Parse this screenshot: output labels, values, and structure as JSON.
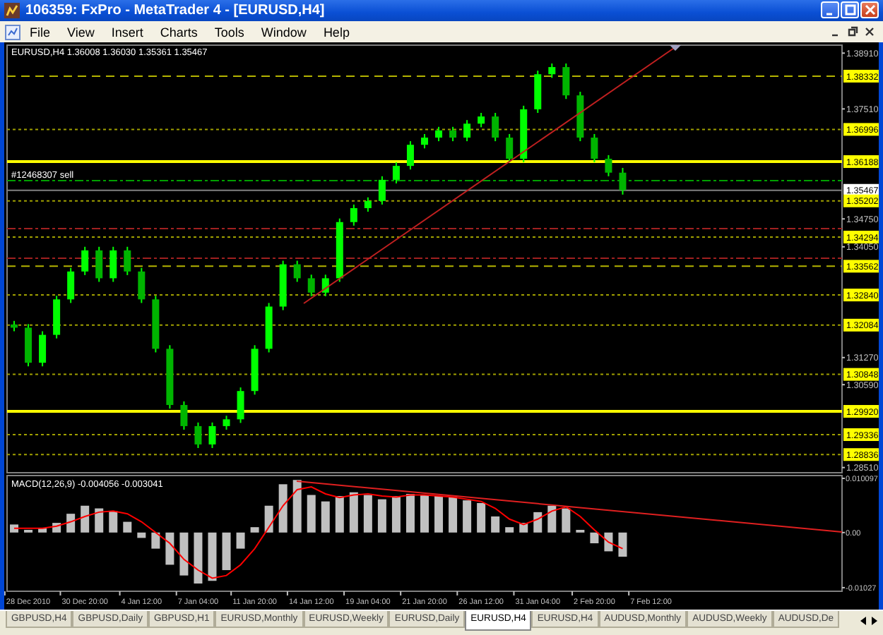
{
  "window": {
    "title": "106359: FxPro - MetaTrader 4 - [EURUSD,H4]"
  },
  "menu": [
    "File",
    "View",
    "Insert",
    "Charts",
    "Tools",
    "Window",
    "Help"
  ],
  "chart": {
    "header": "EURUSD,H4  1.36008 1.36030 1.35361 1.35467",
    "order_label": "#12468307 sell",
    "chart_data": {
      "type": "candlestick",
      "ylim": [
        1.2838,
        1.3911
      ],
      "categories": [
        null,
        null,
        null,
        null,
        null,
        null,
        null,
        null,
        null,
        null,
        null,
        null,
        null,
        null,
        null,
        null,
        null,
        null,
        null,
        null,
        null,
        null,
        null,
        null,
        null,
        null,
        null,
        null,
        null,
        null,
        null,
        null,
        null,
        null,
        null,
        null,
        null,
        null,
        null,
        null,
        null,
        null,
        null,
        null,
        null,
        null,
        null,
        null,
        null,
        null,
        null,
        null,
        null,
        null,
        null,
        null,
        null,
        null,
        null
      ],
      "yticks": [
        {
          "value": 1.3891,
          "label": "1.38910"
        },
        {
          "value": 1.3751,
          "label": "1.37510"
        },
        {
          "value": 1.3475,
          "label": "1.34750"
        },
        {
          "value": 1.3405,
          "label": "1.34050"
        },
        {
          "value": 1.3127,
          "label": "1.31270"
        },
        {
          "value": 1.3059,
          "label": "1.30590"
        },
        {
          "value": 1.2851,
          "label": "1.28510"
        }
      ],
      "ohlc": [
        [
          1.321,
          1.3219,
          1.3193,
          1.3202
        ],
        [
          1.3202,
          1.3211,
          1.3105,
          1.3114
        ],
        [
          1.3114,
          1.3193,
          1.3105,
          1.3184
        ],
        [
          1.3184,
          1.3282,
          1.3175,
          1.3273
        ],
        [
          1.3273,
          1.3352,
          1.3264,
          1.3343
        ],
        [
          1.3343,
          1.3405,
          1.3334,
          1.3396
        ],
        [
          1.3396,
          1.3405,
          1.3317,
          1.3326
        ],
        [
          1.3326,
          1.3405,
          1.3317,
          1.3396
        ],
        [
          1.3396,
          1.3405,
          1.3334,
          1.3343
        ],
        [
          1.3343,
          1.3352,
          1.3264,
          1.3273
        ],
        [
          1.3273,
          1.3282,
          1.314,
          1.3149
        ],
        [
          1.3149,
          1.3158,
          1.2999,
          1.3008
        ],
        [
          1.3008,
          1.3017,
          1.2946,
          1.2955
        ],
        [
          1.2955,
          1.2964,
          1.29,
          1.2909
        ],
        [
          1.2909,
          1.2964,
          1.29,
          1.2955
        ],
        [
          1.2955,
          1.2981,
          1.2946,
          1.2972
        ],
        [
          1.2972,
          1.3052,
          1.2963,
          1.3043
        ],
        [
          1.3043,
          1.3158,
          1.3034,
          1.3149
        ],
        [
          1.3149,
          1.3264,
          1.314,
          1.3255
        ],
        [
          1.3255,
          1.337,
          1.3246,
          1.3361
        ],
        [
          1.3361,
          1.337,
          1.3317,
          1.3326
        ],
        [
          1.3326,
          1.3335,
          1.3281,
          1.329
        ],
        [
          1.329,
          1.3335,
          1.3281,
          1.3326
        ],
        [
          1.3326,
          1.3476,
          1.3317,
          1.3467
        ],
        [
          1.3467,
          1.3511,
          1.3458,
          1.3502
        ],
        [
          1.3502,
          1.3529,
          1.3493,
          1.352
        ],
        [
          1.352,
          1.3582,
          1.3511,
          1.3573
        ],
        [
          1.3573,
          1.3617,
          1.3564,
          1.3608
        ],
        [
          1.3608,
          1.367,
          1.3599,
          1.3661
        ],
        [
          1.3661,
          1.3688,
          1.3652,
          1.3679
        ],
        [
          1.3679,
          1.3706,
          1.367,
          1.3697
        ],
        [
          1.3697,
          1.3706,
          1.367,
          1.3679
        ],
        [
          1.3679,
          1.3723,
          1.367,
          1.3714
        ],
        [
          1.3714,
          1.3741,
          1.3705,
          1.3732
        ],
        [
          1.3732,
          1.3741,
          1.367,
          1.3679
        ],
        [
          1.3679,
          1.3688,
          1.3617,
          1.3626
        ],
        [
          1.3626,
          1.3759,
          1.3617,
          1.375
        ],
        [
          1.375,
          1.3847,
          1.3741,
          1.3838
        ],
        [
          1.3838,
          1.3865,
          1.3829,
          1.3856
        ],
        [
          1.3856,
          1.3865,
          1.3776,
          1.3785
        ],
        [
          1.3785,
          1.3794,
          1.367,
          1.3679
        ],
        [
          1.3679,
          1.3688,
          1.3617,
          1.3626
        ],
        [
          1.3626,
          1.3635,
          1.3582,
          1.3591
        ],
        [
          1.3591,
          1.3603,
          1.3536,
          1.3547
        ],
        null,
        null,
        null,
        null,
        null,
        null,
        null,
        null,
        null,
        null,
        null,
        null,
        null,
        null,
        null
      ],
      "ref_lines": [
        {
          "axis": "y",
          "value": 1.38332,
          "label": "1.38332",
          "color": "#b4b400"
        },
        {
          "axis": "y",
          "value": 1.36996,
          "label": "1.36996",
          "color": "#a0a000"
        },
        {
          "axis": "y",
          "value": 1.36188,
          "label": "1.36188",
          "color": "#ffff00"
        },
        {
          "axis": "y",
          "value": 1.3571,
          "color": "#00a000"
        },
        {
          "axis": "y",
          "value": 1.35467,
          "label": "1.35467",
          "color": "#808080"
        },
        {
          "axis": "y",
          "value": 1.35202,
          "label": "1.35202",
          "color": "#a0a000"
        },
        {
          "axis": "y",
          "value": 1.34505,
          "color": "#a02020"
        },
        {
          "axis": "y",
          "value": 1.34294,
          "label": "1.34294",
          "color": "#a0a000"
        },
        {
          "axis": "y",
          "value": 1.33761,
          "color": "#a02020"
        },
        {
          "axis": "y",
          "value": 1.33562,
          "label": "1.33562",
          "color": "#b4b400"
        },
        {
          "axis": "y",
          "value": 1.3284,
          "label": "1.32840",
          "color": "#a0a000"
        },
        {
          "axis": "y",
          "value": 1.32084,
          "label": "1.32084",
          "color": "#a0a000"
        },
        {
          "axis": "y",
          "value": 1.30848,
          "label": "1.30848",
          "color": "#a0a000"
        },
        {
          "axis": "y",
          "value": 1.2992,
          "label": "1.29920",
          "color": "#ffff00"
        },
        {
          "axis": "y",
          "value": 1.29336,
          "label": "1.29336",
          "color": "#a0a000"
        },
        {
          "axis": "y",
          "value": 1.28836,
          "label": "1.28836",
          "color": "#a0a000"
        }
      ]
    }
  },
  "indicator": {
    "header": "MACD(12,26,9) -0.004056 -0.003041",
    "chart_data": {
      "type": "bar",
      "ylim": [
        -0.01094,
        0.01062
      ],
      "categories": [
        null,
        "28 Dec 2010",
        null,
        null,
        null,
        "30 Dec 20:00",
        null,
        null,
        null,
        "4 Jan 12:00",
        null,
        null,
        null,
        "7 Jan 04:00",
        null,
        null,
        null,
        "11 Jan 20:00",
        null,
        null,
        null,
        "14 Jan 12:00",
        null,
        null,
        null,
        "19 Jan 04:00",
        null,
        null,
        null,
        "21 Jan 20:00",
        null,
        null,
        null,
        "26 Jan 12:00",
        null,
        null,
        null,
        "31 Jan 04:00",
        null,
        null,
        null,
        "2 Feb 20:00",
        null,
        null,
        null,
        "7 Feb 12:00",
        null,
        null,
        null,
        null,
        null,
        null,
        null,
        null,
        null,
        null,
        null,
        null,
        null
      ],
      "yticks": [
        {
          "value": 0.010097,
          "label": "0.010097"
        },
        {
          "value": 0,
          "label": "0.00"
        },
        {
          "value": -0.01027,
          "label": "-0.01027"
        }
      ],
      "series": [
        {
          "color": "#c0c0c0",
          "values": [
            0.0015,
            0.0005,
            0.0008,
            0.0018,
            0.0035,
            0.005,
            0.0045,
            0.004,
            0.002,
            -0.001,
            -0.003,
            -0.006,
            -0.008,
            -0.0095,
            -0.009,
            -0.007,
            -0.003,
            0.001,
            0.005,
            0.009,
            0.0098,
            0.007,
            0.0058,
            0.0068,
            0.0075,
            0.007,
            0.0062,
            0.0068,
            0.0072,
            0.007,
            0.0068,
            0.0066,
            0.006,
            0.0055,
            0.003,
            0.001,
            0.0018,
            0.0038,
            0.005,
            0.0045,
            0.0005,
            -0.002,
            -0.0035,
            -0.0045,
            null,
            null,
            null,
            null,
            null,
            null,
            null,
            null,
            null,
            null,
            null,
            null,
            null,
            null,
            null
          ]
        },
        {
          "type": "line",
          "color": "#ff0000",
          "values": [
            0.0008,
            0.0008,
            0.0008,
            0.0012,
            0.002,
            0.003,
            0.0038,
            0.004,
            0.0035,
            0.002,
            0.0,
            -0.002,
            -0.005,
            -0.007,
            -0.0085,
            -0.008,
            -0.006,
            -0.003,
            0.001,
            0.005,
            0.008,
            0.0085,
            0.0072,
            0.0065,
            0.007,
            0.0072,
            0.0068,
            0.0066,
            0.007,
            0.007,
            0.0068,
            0.0066,
            0.0062,
            0.0058,
            0.0045,
            0.0025,
            0.0015,
            0.0025,
            0.004,
            0.0048,
            0.003,
            0.0005,
            -0.0018,
            -0.003,
            null,
            null,
            null,
            null,
            null,
            null,
            null,
            null,
            null,
            null,
            null,
            null,
            null,
            null,
            null
          ]
        }
      ]
    }
  },
  "tabs": [
    {
      "label": "GBPUSD,H4",
      "selected": false
    },
    {
      "label": "GBPUSD,Daily",
      "selected": false
    },
    {
      "label": "GBPUSD,H1",
      "selected": false
    },
    {
      "label": "EURUSD,Monthly",
      "selected": false
    },
    {
      "label": "EURUSD,Weekly",
      "selected": false
    },
    {
      "label": "EURUSD,Daily",
      "selected": false
    },
    {
      "label": "EURUSD,H4",
      "selected": true
    },
    {
      "label": "EURUSD,H4",
      "selected": false
    },
    {
      "label": "AUDUSD,Monthly",
      "selected": false
    },
    {
      "label": "AUDUSD,Weekly",
      "selected": false
    },
    {
      "label": "AUDUSD,De",
      "selected": false
    }
  ]
}
